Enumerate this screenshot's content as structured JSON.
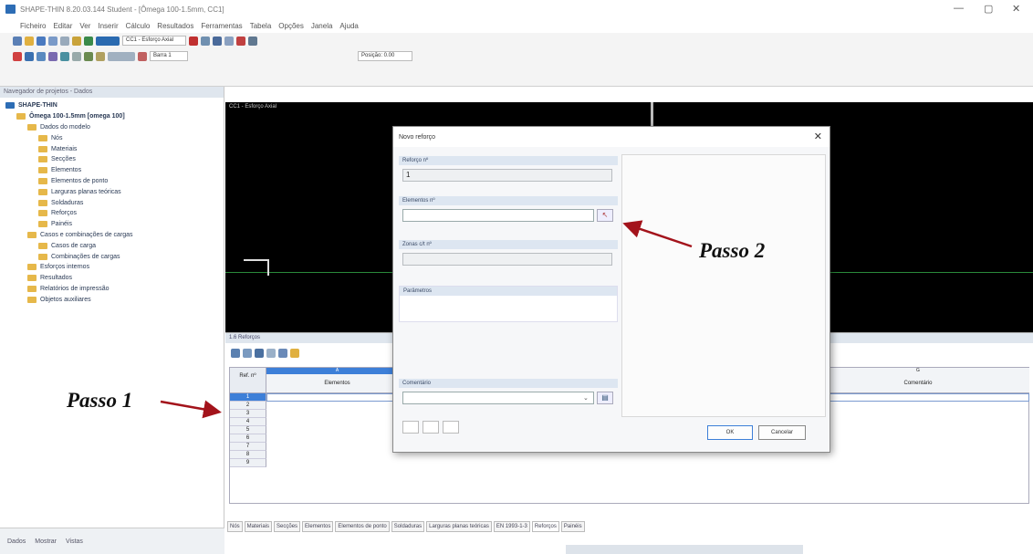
{
  "window": {
    "title": "SHAPE-THIN 8.20.03.144 Student - [Ômega 100-1.5mm, CC1]",
    "controls": [
      "—",
      "▢",
      "✕"
    ]
  },
  "menu": [
    "Ficheiro",
    "Editar",
    "Ver",
    "Inserir",
    "Cálculo",
    "Resultados",
    "Ferramentas",
    "Tabela",
    "Opções",
    "Janela",
    "Ajuda"
  ],
  "toolbar": {
    "loadcase": "CC1 - Esforço Axial",
    "series": "Barra 1",
    "position": "Posição: 0.00"
  },
  "navigator": {
    "title": "Navegador de projetos - Dados",
    "items": [
      {
        "label": "SHAPE-THIN",
        "level": 0
      },
      {
        "label": "Ômega 100-1.5mm [omega 100]",
        "level": 1
      },
      {
        "label": "Dados do modelo",
        "level": 2
      },
      {
        "label": "Nós",
        "level": 3
      },
      {
        "label": "Materiais",
        "level": 3
      },
      {
        "label": "Secções",
        "level": 3
      },
      {
        "label": "Elementos",
        "level": 3
      },
      {
        "label": "Elementos de ponto",
        "level": 3
      },
      {
        "label": "Larguras planas teóricas",
        "level": 3
      },
      {
        "label": "Soldaduras",
        "level": 3
      },
      {
        "label": "Reforços",
        "level": 3
      },
      {
        "label": "Painéis",
        "level": 3
      },
      {
        "label": "Casos e combinações de cargas",
        "level": 2
      },
      {
        "label": "Casos de carga",
        "level": 3
      },
      {
        "label": "Combinações de cargas",
        "level": 3
      },
      {
        "label": "Esforços internos",
        "level": 2
      },
      {
        "label": "Resultados",
        "level": 2
      },
      {
        "label": "Relatórios de impressão",
        "level": 2
      },
      {
        "label": "Objetos auxiliares",
        "level": 2
      }
    ],
    "footer_tabs": [
      "Dados",
      "Mostrar",
      "Vistas"
    ]
  },
  "canvas": {
    "label": "CC1 - Esforço Axial"
  },
  "table": {
    "title": "1.6 Reforços",
    "col_letters": [
      "A",
      "G"
    ],
    "headers": [
      "Ref. nº",
      "Elementos",
      "Comentário"
    ],
    "rows": [
      "1",
      "2",
      "3",
      "4",
      "5",
      "6",
      "7",
      "8",
      "9"
    ],
    "tabs": [
      "Nós",
      "Materiais",
      "Secções",
      "Elementos",
      "Elementos de ponto",
      "Soldaduras",
      "Larguras planas teóricas",
      "EN 1993-1-3",
      "Reforços",
      "Painéis"
    ]
  },
  "dialog": {
    "title": "Novo reforço",
    "ref_label": "Reforço nº",
    "ref_value": "1",
    "elements_label": "Elementos nº",
    "elements_value": "",
    "zones_label": "Zonas c/t nº",
    "params_label": "Parâmetros",
    "comment_label": "Comentário",
    "ok": "OK",
    "cancel": "Cancelar"
  },
  "annotations": {
    "step1": "Passo 1",
    "step2": "Passo 2",
    "arrow_color": "#a3131b"
  }
}
